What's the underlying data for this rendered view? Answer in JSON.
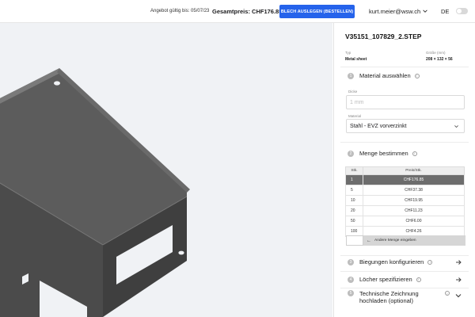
{
  "header": {
    "quote_valid": "Angebot gültig bis: 05/07/23",
    "total_prefix": "Gesamtpreis:",
    "total_value": "CHF176.85",
    "order_button": "BLECH AUSLEGEN (BESTELLEN)",
    "user_email": "kurt.meier@wsw.ch",
    "language": "DE"
  },
  "sidebar": {
    "filename": "V35151_107829_2.STEP",
    "type_label": "Typ",
    "type_value": "Metal sheet",
    "size_label": "Größe (mm)",
    "size_value": "208 × 132 × 56",
    "steps": [
      {
        "num": "1",
        "label": "Material auswählen"
      },
      {
        "num": "2",
        "label": "Menge bestimmen"
      },
      {
        "num": "3",
        "label": "Biegungen konfigurieren"
      },
      {
        "num": "4",
        "label": "Löcher spezifizieren"
      },
      {
        "num": "5",
        "label": "Technische Zeichnung hochladen (optional)"
      }
    ],
    "thickness_label": "Dicke",
    "thickness_placeholder": "1 mm",
    "material_label": "Material",
    "material_value": "Stahl - EVZ vorverzinkt",
    "qty_table": {
      "headers": [
        "Stk.",
        "Preis/Stk."
      ],
      "rows": [
        {
          "qty": "1",
          "price": "CHF176.85"
        },
        {
          "qty": "5",
          "price": "CHF37.38"
        },
        {
          "qty": "10",
          "price": "CHF19.95"
        },
        {
          "qty": "20",
          "price": "CHF11.23"
        },
        {
          "qty": "50",
          "price": "CHF6.00"
        },
        {
          "qty": "100",
          "price": "CHF4.26"
        }
      ],
      "selected_index": 0
    },
    "custom_qty_button": "Andere Menge eingeben"
  },
  "icons": {
    "user_menu": "chevron-down-icon",
    "step_next": "arrow-right-icon",
    "step_expand": "chevron-down-icon",
    "info": "info-icon",
    "custom_qty": "arrow-left-icon"
  },
  "colors": {
    "accent": "#2563eb",
    "selected_row": "#6d6d6d",
    "part": "#5c5c5c"
  }
}
